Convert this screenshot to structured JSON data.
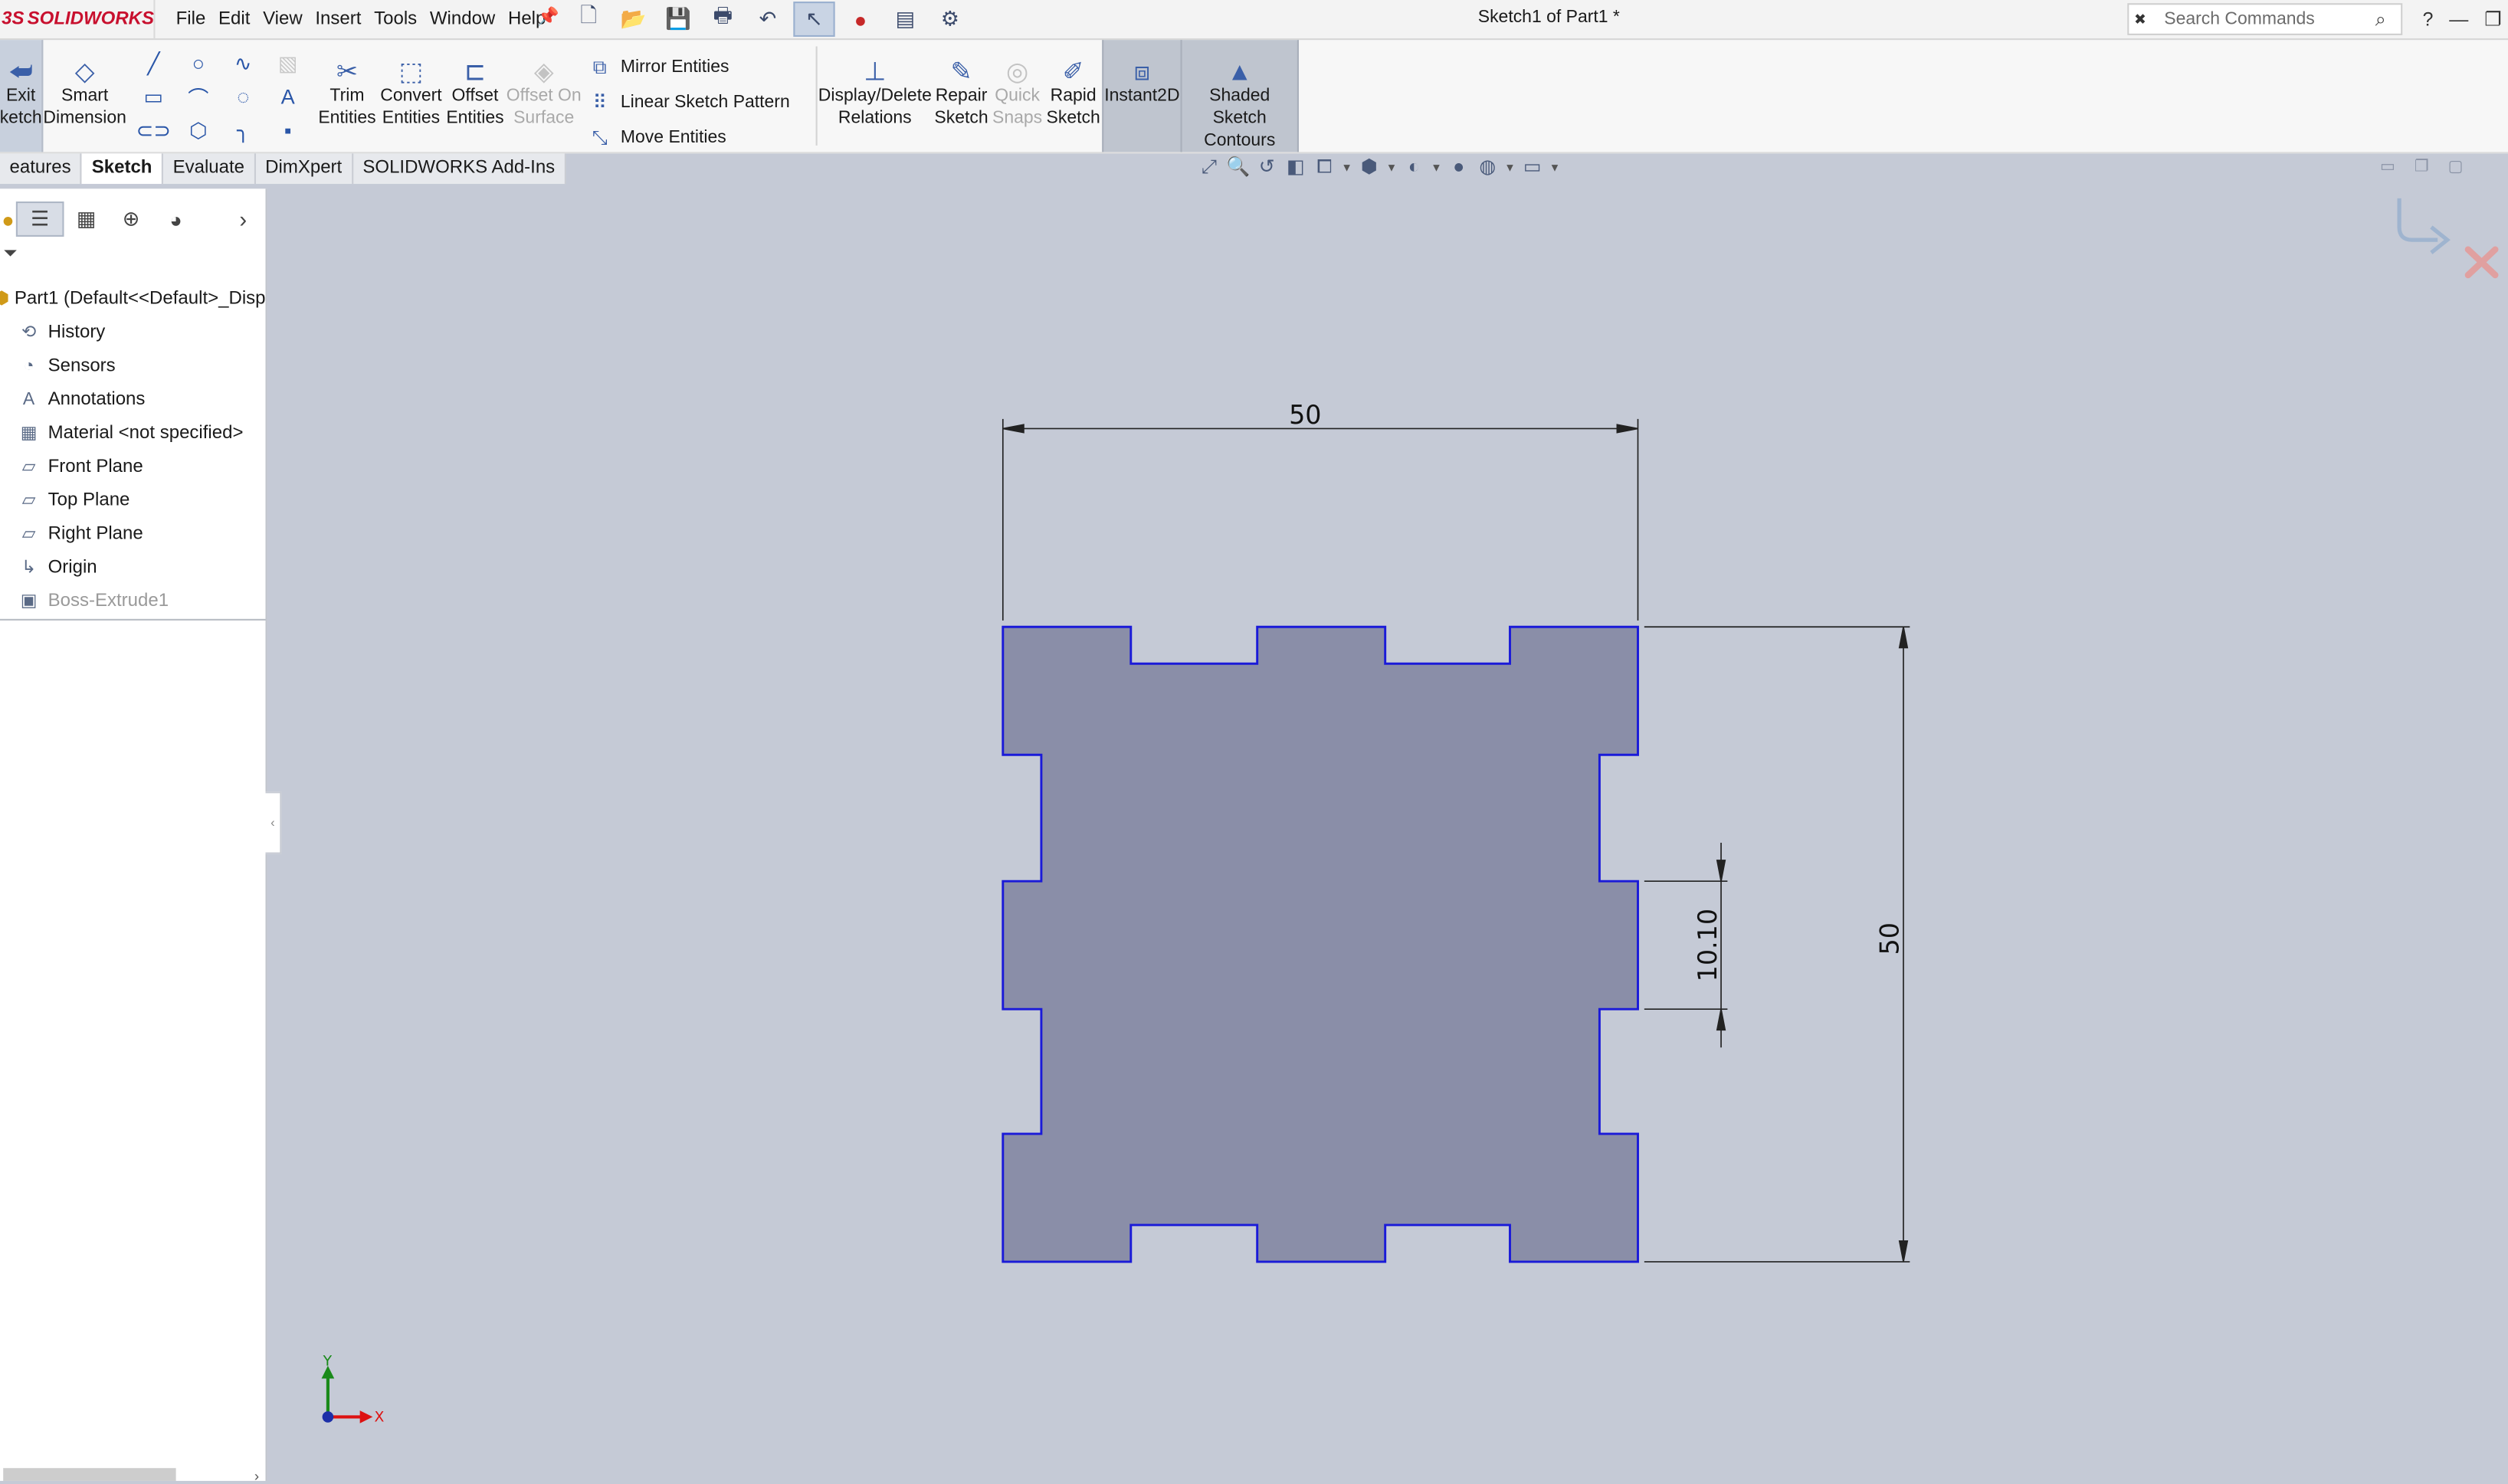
{
  "app": {
    "brand": "SOLIDWORKS",
    "brand_prefix": "3S",
    "window_title": "Sketch1 of Part1 *",
    "search_placeholder": "Search Commands",
    "help_label": "?"
  },
  "menu": [
    "File",
    "Edit",
    "View",
    "Insert",
    "Tools",
    "Window",
    "Help"
  ],
  "ribbon": {
    "exit_sketch": [
      "Exit",
      "ketch"
    ],
    "smart_dimension": [
      "Smart",
      "Dimension"
    ],
    "trim_entities": [
      "Trim",
      "Entities"
    ],
    "convert_entities": [
      "Convert",
      "Entities"
    ],
    "offset_entities": [
      "Offset",
      "Entities"
    ],
    "offset_on_surface": [
      "Offset On",
      "Surface"
    ],
    "mirror_entities": "Mirror Entities",
    "linear_sketch_pattern": "Linear Sketch Pattern",
    "move_entities": "Move Entities",
    "display_delete_relations": [
      "Display/Delete",
      "Relations"
    ],
    "repair_sketch": [
      "Repair",
      "Sketch"
    ],
    "quick_snaps": [
      "Quick",
      "Snaps"
    ],
    "rapid_sketch": [
      "Rapid",
      "Sketch"
    ],
    "instant2d": "Instant2D",
    "shaded_sketch_contours": [
      "Shaded Sketch",
      "Contours"
    ]
  },
  "tabs": [
    {
      "label": "eatures",
      "active": false
    },
    {
      "label": "Sketch",
      "active": true
    },
    {
      "label": "Evaluate",
      "active": false
    },
    {
      "label": "DimXpert",
      "active": false
    },
    {
      "label": "SOLIDWORKS Add-Ins",
      "active": false
    }
  ],
  "feature_tree": [
    {
      "label": "Part1  (Default<<Default>_Disp",
      "icon": "part-icon",
      "gray": false,
      "root": true
    },
    {
      "label": "History",
      "icon": "history-icon",
      "gray": false
    },
    {
      "label": "Sensors",
      "icon": "sensor-icon",
      "gray": false
    },
    {
      "label": "Annotations",
      "icon": "annotations-icon",
      "gray": false
    },
    {
      "label": "Material <not specified>",
      "icon": "material-icon",
      "gray": false
    },
    {
      "label": "Front Plane",
      "icon": "plane-icon",
      "gray": false
    },
    {
      "label": "Top Plane",
      "icon": "plane-icon",
      "gray": false
    },
    {
      "label": "Right Plane",
      "icon": "plane-icon",
      "gray": false
    },
    {
      "label": "Origin",
      "icon": "origin-icon",
      "gray": false
    },
    {
      "label": "Boss-Extrude1",
      "icon": "extrude-icon",
      "gray": true
    }
  ],
  "sketch": {
    "dim_width": "50",
    "dim_height": "50",
    "dim_tab": "10.10",
    "fill_color": "#8a8ea8",
    "edge_color": "#1a1ad8"
  },
  "axes": {
    "x": "X",
    "y": "Y"
  }
}
